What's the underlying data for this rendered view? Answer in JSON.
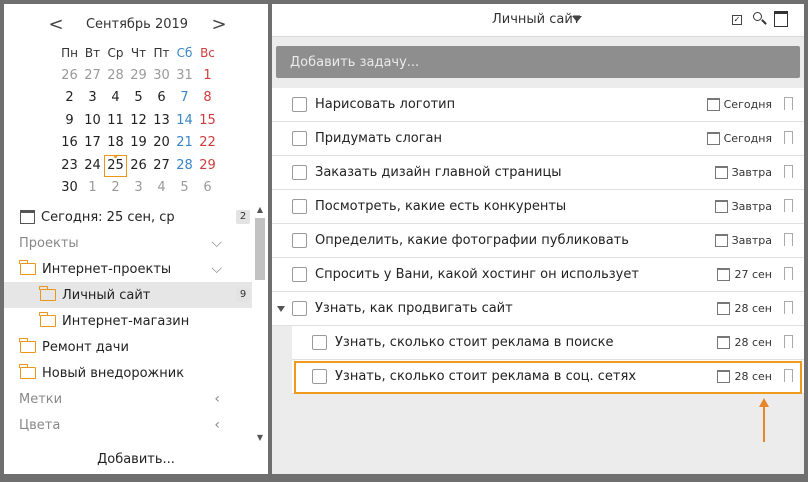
{
  "calendar": {
    "prev": "<",
    "next": ">",
    "month_title": "Сентябрь 2019",
    "weekdays": [
      "Пн",
      "Вт",
      "Ср",
      "Чт",
      "Пт",
      "Сб",
      "Вс"
    ],
    "weeks": [
      [
        "26",
        "27",
        "28",
        "29",
        "30",
        "31",
        "1"
      ],
      [
        "2",
        "3",
        "4",
        "5",
        "6",
        "7",
        "8"
      ],
      [
        "9",
        "10",
        "11",
        "12",
        "13",
        "14",
        "15"
      ],
      [
        "16",
        "17",
        "18",
        "19",
        "20",
        "21",
        "22"
      ],
      [
        "23",
        "24",
        "25",
        "26",
        "27",
        "28",
        "29"
      ],
      [
        "30",
        "1",
        "2",
        "3",
        "4",
        "5",
        "6"
      ]
    ],
    "selected_day": "25"
  },
  "nav": {
    "today": {
      "label": "Сегодня: 25 сен, ср",
      "count": "2"
    },
    "projects_label": "Проекты",
    "internet_projects": "Интернет-проекты",
    "personal_site": {
      "label": "Личный сайт",
      "count": "9"
    },
    "online_shop": "Интернет-магазин",
    "dacha": "Ремонт дачи",
    "suv": "Новый внедорожник",
    "tags_label": "Метки",
    "colors_label": "Цвета"
  },
  "add_link": "Добавить...",
  "toolbar": {
    "project_title": "Личный сайт",
    "check_glyph": "✓"
  },
  "add_task": {
    "placeholder": "Добавить задачу..."
  },
  "tasks": [
    {
      "title": "Нарисовать логотип",
      "due": "Сегодня"
    },
    {
      "title": "Придумать слоган",
      "due": "Сегодня"
    },
    {
      "title": "Заказать дизайн главной страницы",
      "due": "Завтра"
    },
    {
      "title": "Посмотреть, какие есть конкуренты",
      "due": "Завтра"
    },
    {
      "title": "Определить, какие фотографии публиковать",
      "due": "Завтра"
    },
    {
      "title": "Спросить у Вани, какой хостинг он использует",
      "due": "27 сен"
    },
    {
      "title": "Узнать, как продвигать сайт",
      "due": "28 сен"
    },
    {
      "title": "Узнать, сколько стоит реклама в поиске",
      "due": "28 сен"
    },
    {
      "title": "Узнать, сколько стоит реклама в соц. сетях",
      "due": "28 сен"
    }
  ]
}
